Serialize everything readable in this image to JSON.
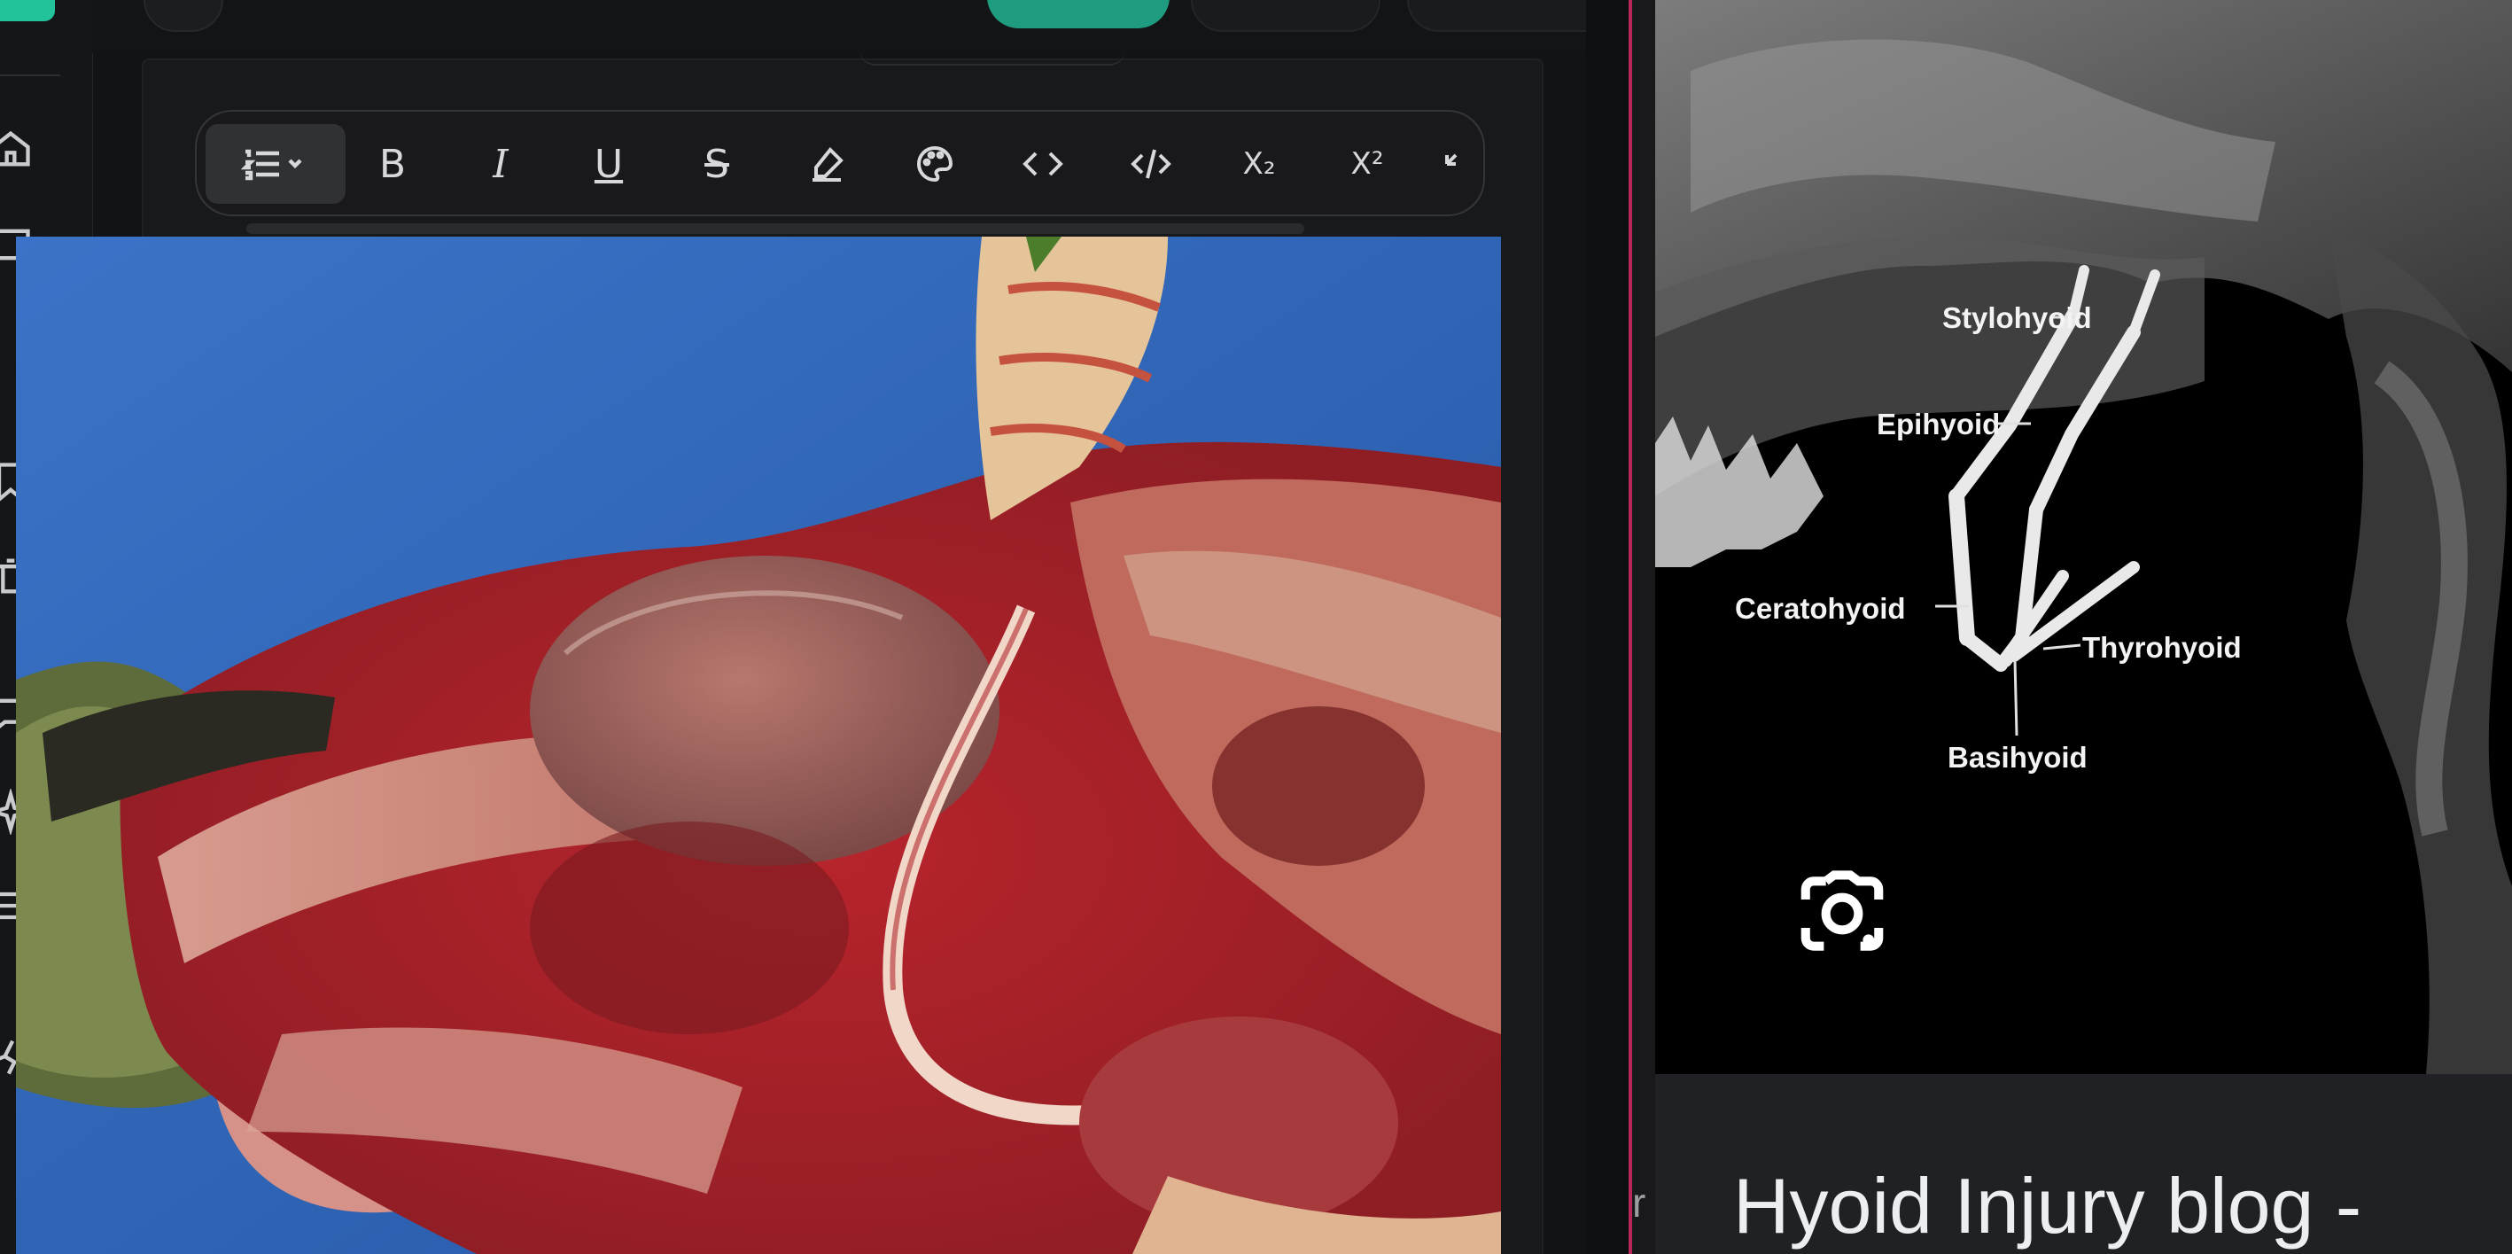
{
  "editor": {
    "toolbar": {
      "buttons": [
        {
          "name": "list-format-button",
          "icon": "numbered-list-icon"
        },
        {
          "name": "bold-button",
          "label": "B"
        },
        {
          "name": "italic-button",
          "label": "I"
        },
        {
          "name": "underline-button",
          "label": "U"
        },
        {
          "name": "strikethrough-button",
          "label": "S"
        },
        {
          "name": "highlight-button",
          "icon": "highlighter-icon"
        },
        {
          "name": "text-color-button",
          "icon": "palette-icon"
        },
        {
          "name": "inline-code-button",
          "icon": "code-icon"
        },
        {
          "name": "code-block-button",
          "icon": "code-slash-icon"
        },
        {
          "name": "subscript-button",
          "label": "X₂"
        },
        {
          "name": "superscript-button",
          "label": "X²"
        },
        {
          "name": "undo-button",
          "icon": "undo-icon"
        }
      ]
    }
  },
  "viewer": {
    "labels": {
      "stylohyoid": "Stylohyoid",
      "epihyoid": "Epihyoid",
      "ceratohyoid": "Ceratohyoid",
      "thyrohyoid": "Thyrohyoid",
      "basihyoid": "Basihyoid"
    },
    "lens_icon": "google-lens-icon",
    "title": "Hyoid Injury blog -",
    "edge_text": "r"
  },
  "colors": {
    "accent_green": "#22c39a",
    "divider_pink": "#b8265e",
    "surgical_drape_blue": "#2f65b8"
  }
}
